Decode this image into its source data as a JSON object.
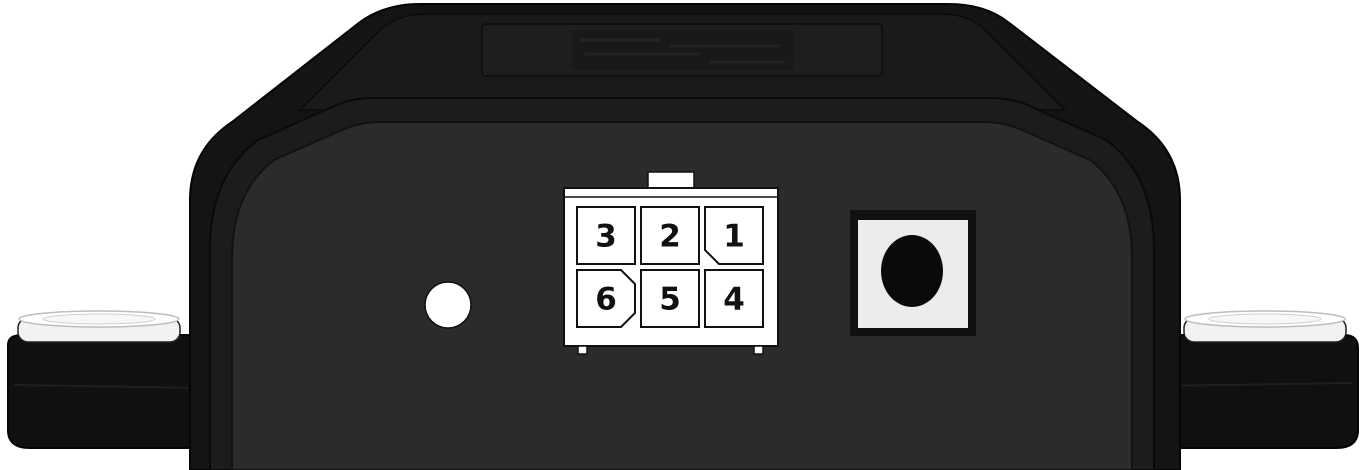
{
  "device": {
    "body_color": "#141414",
    "face_color": "#2b2b2b",
    "mount_color": "#0f0f0f",
    "washer_color": "#f2f2f2"
  },
  "connector": {
    "housing_color": "#ffffff",
    "outline_color": "#111111",
    "pins": [
      {
        "number": "3",
        "row": 0,
        "col": 0,
        "shape": "square"
      },
      {
        "number": "2",
        "row": 0,
        "col": 1,
        "shape": "square"
      },
      {
        "number": "1",
        "row": 0,
        "col": 2,
        "shape": "chamfer-bottom-left"
      },
      {
        "number": "6",
        "row": 1,
        "col": 0,
        "shape": "chamfer-right"
      },
      {
        "number": "5",
        "row": 1,
        "col": 1,
        "shape": "square"
      },
      {
        "number": "4",
        "row": 1,
        "col": 2,
        "shape": "square"
      }
    ]
  },
  "led_color": "#ffffff",
  "jack": {
    "frame_color": "#111111",
    "face_color": "#ececec",
    "hole_color": "#0a0a0a"
  }
}
